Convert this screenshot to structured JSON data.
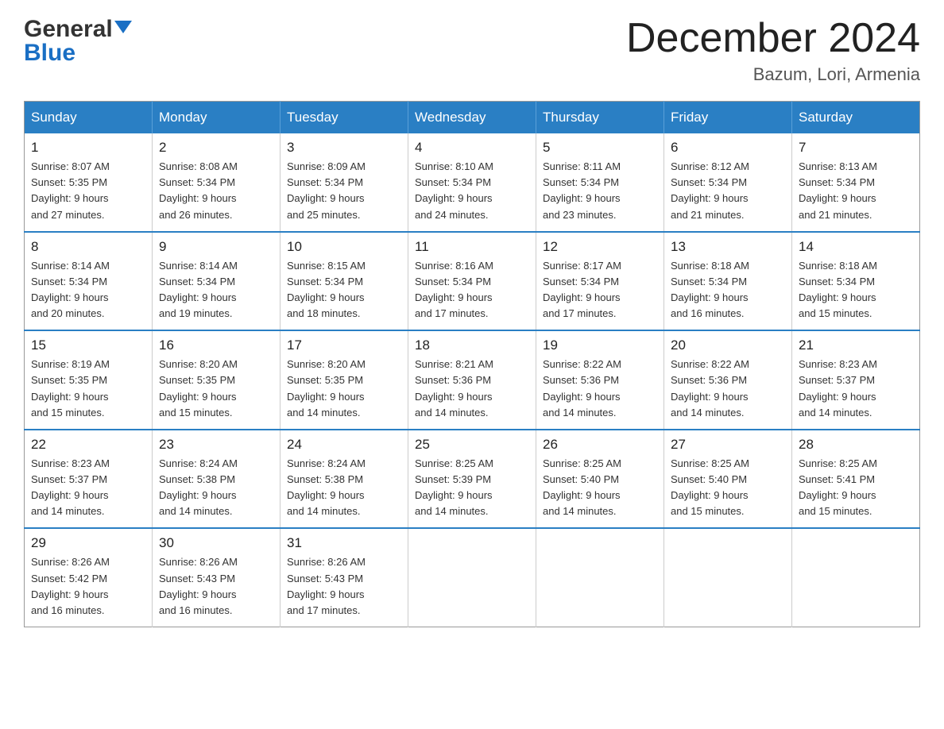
{
  "header": {
    "logo_general": "General",
    "logo_blue": "Blue",
    "month_title": "December 2024",
    "location": "Bazum, Lori, Armenia"
  },
  "days_of_week": [
    "Sunday",
    "Monday",
    "Tuesday",
    "Wednesday",
    "Thursday",
    "Friday",
    "Saturday"
  ],
  "weeks": [
    [
      {
        "day": "1",
        "sunrise": "8:07 AM",
        "sunset": "5:35 PM",
        "daylight": "9 hours and 27 minutes."
      },
      {
        "day": "2",
        "sunrise": "8:08 AM",
        "sunset": "5:34 PM",
        "daylight": "9 hours and 26 minutes."
      },
      {
        "day": "3",
        "sunrise": "8:09 AM",
        "sunset": "5:34 PM",
        "daylight": "9 hours and 25 minutes."
      },
      {
        "day": "4",
        "sunrise": "8:10 AM",
        "sunset": "5:34 PM",
        "daylight": "9 hours and 24 minutes."
      },
      {
        "day": "5",
        "sunrise": "8:11 AM",
        "sunset": "5:34 PM",
        "daylight": "9 hours and 23 minutes."
      },
      {
        "day": "6",
        "sunrise": "8:12 AM",
        "sunset": "5:34 PM",
        "daylight": "9 hours and 21 minutes."
      },
      {
        "day": "7",
        "sunrise": "8:13 AM",
        "sunset": "5:34 PM",
        "daylight": "9 hours and 21 minutes."
      }
    ],
    [
      {
        "day": "8",
        "sunrise": "8:14 AM",
        "sunset": "5:34 PM",
        "daylight": "9 hours and 20 minutes."
      },
      {
        "day": "9",
        "sunrise": "8:14 AM",
        "sunset": "5:34 PM",
        "daylight": "9 hours and 19 minutes."
      },
      {
        "day": "10",
        "sunrise": "8:15 AM",
        "sunset": "5:34 PM",
        "daylight": "9 hours and 18 minutes."
      },
      {
        "day": "11",
        "sunrise": "8:16 AM",
        "sunset": "5:34 PM",
        "daylight": "9 hours and 17 minutes."
      },
      {
        "day": "12",
        "sunrise": "8:17 AM",
        "sunset": "5:34 PM",
        "daylight": "9 hours and 17 minutes."
      },
      {
        "day": "13",
        "sunrise": "8:18 AM",
        "sunset": "5:34 PM",
        "daylight": "9 hours and 16 minutes."
      },
      {
        "day": "14",
        "sunrise": "8:18 AM",
        "sunset": "5:34 PM",
        "daylight": "9 hours and 15 minutes."
      }
    ],
    [
      {
        "day": "15",
        "sunrise": "8:19 AM",
        "sunset": "5:35 PM",
        "daylight": "9 hours and 15 minutes."
      },
      {
        "day": "16",
        "sunrise": "8:20 AM",
        "sunset": "5:35 PM",
        "daylight": "9 hours and 15 minutes."
      },
      {
        "day": "17",
        "sunrise": "8:20 AM",
        "sunset": "5:35 PM",
        "daylight": "9 hours and 14 minutes."
      },
      {
        "day": "18",
        "sunrise": "8:21 AM",
        "sunset": "5:36 PM",
        "daylight": "9 hours and 14 minutes."
      },
      {
        "day": "19",
        "sunrise": "8:22 AM",
        "sunset": "5:36 PM",
        "daylight": "9 hours and 14 minutes."
      },
      {
        "day": "20",
        "sunrise": "8:22 AM",
        "sunset": "5:36 PM",
        "daylight": "9 hours and 14 minutes."
      },
      {
        "day": "21",
        "sunrise": "8:23 AM",
        "sunset": "5:37 PM",
        "daylight": "9 hours and 14 minutes."
      }
    ],
    [
      {
        "day": "22",
        "sunrise": "8:23 AM",
        "sunset": "5:37 PM",
        "daylight": "9 hours and 14 minutes."
      },
      {
        "day": "23",
        "sunrise": "8:24 AM",
        "sunset": "5:38 PM",
        "daylight": "9 hours and 14 minutes."
      },
      {
        "day": "24",
        "sunrise": "8:24 AM",
        "sunset": "5:38 PM",
        "daylight": "9 hours and 14 minutes."
      },
      {
        "day": "25",
        "sunrise": "8:25 AM",
        "sunset": "5:39 PM",
        "daylight": "9 hours and 14 minutes."
      },
      {
        "day": "26",
        "sunrise": "8:25 AM",
        "sunset": "5:40 PM",
        "daylight": "9 hours and 14 minutes."
      },
      {
        "day": "27",
        "sunrise": "8:25 AM",
        "sunset": "5:40 PM",
        "daylight": "9 hours and 15 minutes."
      },
      {
        "day": "28",
        "sunrise": "8:25 AM",
        "sunset": "5:41 PM",
        "daylight": "9 hours and 15 minutes."
      }
    ],
    [
      {
        "day": "29",
        "sunrise": "8:26 AM",
        "sunset": "5:42 PM",
        "daylight": "9 hours and 16 minutes."
      },
      {
        "day": "30",
        "sunrise": "8:26 AM",
        "sunset": "5:43 PM",
        "daylight": "9 hours and 16 minutes."
      },
      {
        "day": "31",
        "sunrise": "8:26 AM",
        "sunset": "5:43 PM",
        "daylight": "9 hours and 17 minutes."
      },
      null,
      null,
      null,
      null
    ]
  ],
  "labels": {
    "sunrise_prefix": "Sunrise: ",
    "sunset_prefix": "Sunset: ",
    "daylight_prefix": "Daylight: "
  }
}
